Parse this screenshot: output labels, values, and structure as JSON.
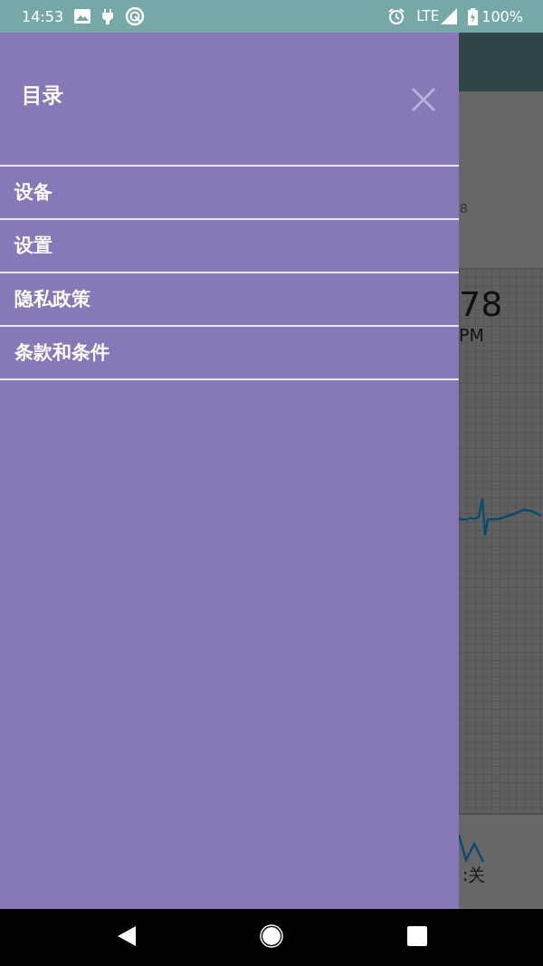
{
  "status_bar": {
    "time": "14:53",
    "network": "LTE",
    "battery": "100%"
  },
  "drawer": {
    "title": "目录",
    "items": [
      {
        "label": "设备"
      },
      {
        "label": "设置"
      },
      {
        "label": "隐私政策"
      },
      {
        "label": "条款和条件"
      }
    ]
  },
  "background": {
    "reading_fragment": "8",
    "heart_rate": "78",
    "unit": "PM",
    "footer_fragment": ":关"
  }
}
